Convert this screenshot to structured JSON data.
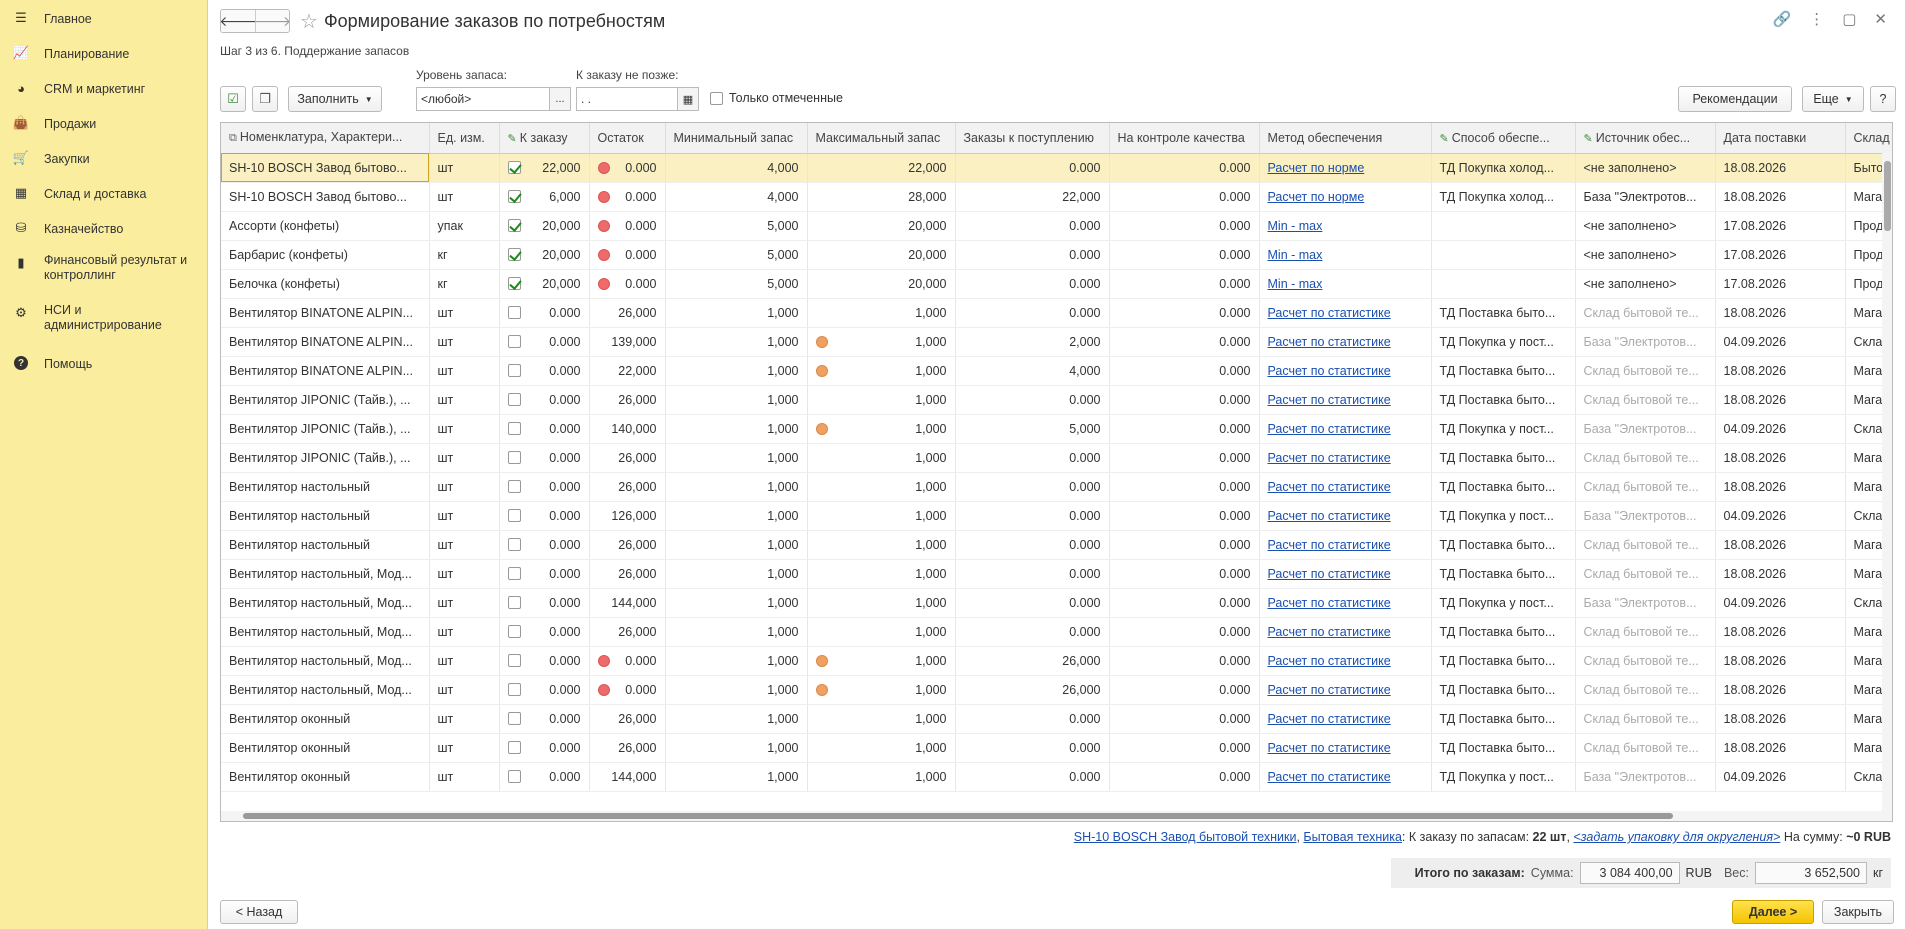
{
  "sidebar": {
    "items": [
      {
        "label": "Главное",
        "icon": "menu-icon"
      },
      {
        "label": "Планирование",
        "icon": "chart-icon"
      },
      {
        "label": "CRM и маркетинг",
        "icon": "pie-icon"
      },
      {
        "label": "Продажи",
        "icon": "bag-icon"
      },
      {
        "label": "Закупки",
        "icon": "cart-icon"
      },
      {
        "label": "Склад и доставка",
        "icon": "grid-icon"
      },
      {
        "label": "Казначейство",
        "icon": "coins-icon"
      },
      {
        "label": "Финансовый результат и контроллинг",
        "icon": "bar-chart-icon"
      },
      {
        "label": "НСИ и администрирование",
        "icon": "gear-icon"
      },
      {
        "label": "Помощь",
        "icon": "help-icon"
      }
    ]
  },
  "header": {
    "title": "Формирование заказов по потребностям",
    "step": "Шаг 3 из 6. Поддержание запасов"
  },
  "toolbar": {
    "fill_label": "Заполнить",
    "stock_level_label": "Уровень запаса:",
    "stock_level_value": "<любой>",
    "order_by_label": "К заказу не позже:",
    "order_by_value": ". .",
    "only_marked_label": "Только отмеченные",
    "recommendations_label": "Рекомендации",
    "more_label": "Еще",
    "help_label": "?"
  },
  "table": {
    "headers": [
      "Номенклатура, Характери...",
      "Ед. изм.",
      "К заказу",
      "Остаток",
      "Минимальный запас",
      "Максимальный запас",
      "Заказы к поступлению",
      "На контроле качества",
      "Метод обеспечения",
      "Способ обеспе...",
      "Источник обес...",
      "Дата поставки",
      "Склад"
    ],
    "rows": [
      {
        "name": "SH-10 BOSCH Завод бытово...",
        "unit": "шт",
        "checked": true,
        "order": "22,000",
        "rest_dot": "red",
        "rest": "0.000",
        "min": "4,000",
        "max": "22,000",
        "in_dot": "",
        "incoming": "0.000",
        "qc": "0.000",
        "method": "Расчет по норме",
        "way": "ТД Покупка холод...",
        "source": "<не заполнено>",
        "source_grey": false,
        "date": "18.08.2026",
        "wh": "Бытова"
      },
      {
        "name": "SH-10 BOSCH Завод бытово...",
        "unit": "шт",
        "checked": true,
        "order": "6,000",
        "rest_dot": "red",
        "rest": "0.000",
        "min": "4,000",
        "max": "28,000",
        "in_dot": "",
        "incoming": "22,000",
        "qc": "0.000",
        "method": "Расчет по норме",
        "way": "ТД Покупка холод...",
        "source": "База \"Электротов...",
        "source_grey": false,
        "date": "18.08.2026",
        "wh": "Магази"
      },
      {
        "name": "Ассорти (конфеты)",
        "unit": "упак",
        "checked": true,
        "order": "20,000",
        "rest_dot": "red",
        "rest": "0.000",
        "min": "5,000",
        "max": "20,000",
        "in_dot": "",
        "incoming": "0.000",
        "qc": "0.000",
        "method": "Min - max",
        "way": "",
        "source": "<не заполнено>",
        "source_grey": false,
        "date": "17.08.2026",
        "wh": "Продук"
      },
      {
        "name": "Барбарис (конфеты)",
        "unit": "кг",
        "checked": true,
        "order": "20,000",
        "rest_dot": "red",
        "rest": "0.000",
        "min": "5,000",
        "max": "20,000",
        "in_dot": "",
        "incoming": "0.000",
        "qc": "0.000",
        "method": "Min - max",
        "way": "",
        "source": "<не заполнено>",
        "source_grey": false,
        "date": "17.08.2026",
        "wh": "Продук"
      },
      {
        "name": "Белочка (конфеты)",
        "unit": "кг",
        "checked": true,
        "order": "20,000",
        "rest_dot": "red",
        "rest": "0.000",
        "min": "5,000",
        "max": "20,000",
        "in_dot": "",
        "incoming": "0.000",
        "qc": "0.000",
        "method": "Min - max",
        "way": "",
        "source": "<не заполнено>",
        "source_grey": false,
        "date": "17.08.2026",
        "wh": "Продук"
      },
      {
        "name": "Вентилятор BINATONE ALPIN...",
        "unit": "шт",
        "checked": false,
        "order": "0.000",
        "rest_dot": "",
        "rest": "26,000",
        "min": "1,000",
        "max": "1,000",
        "in_dot": "",
        "incoming": "0.000",
        "qc": "0.000",
        "method": "Расчет по статистике",
        "way": "ТД Поставка быто...",
        "source": "Склад бытовой те...",
        "source_grey": true,
        "date": "18.08.2026",
        "wh": "Магази"
      },
      {
        "name": "Вентилятор BINATONE ALPIN...",
        "unit": "шт",
        "checked": false,
        "order": "0.000",
        "rest_dot": "",
        "rest": "139,000",
        "min": "1,000",
        "max": "1,000",
        "in_dot": "or",
        "incoming": "2,000",
        "qc": "0.000",
        "method": "Расчет по статистике",
        "way": "ТД Покупка у пост...",
        "source": "База \"Электротов...",
        "source_grey": true,
        "date": "04.09.2026",
        "wh": "Склад"
      },
      {
        "name": "Вентилятор BINATONE ALPIN...",
        "unit": "шт",
        "checked": false,
        "order": "0.000",
        "rest_dot": "",
        "rest": "22,000",
        "min": "1,000",
        "max": "1,000",
        "in_dot": "or",
        "incoming": "4,000",
        "qc": "0.000",
        "method": "Расчет по статистике",
        "way": "ТД Поставка быто...",
        "source": "Склад бытовой те...",
        "source_grey": true,
        "date": "18.08.2026",
        "wh": "Магази"
      },
      {
        "name": "Вентилятор JIPONIC (Тайв.), ...",
        "unit": "шт",
        "checked": false,
        "order": "0.000",
        "rest_dot": "",
        "rest": "26,000",
        "min": "1,000",
        "max": "1,000",
        "in_dot": "",
        "incoming": "0.000",
        "qc": "0.000",
        "method": "Расчет по статистике",
        "way": "ТД Поставка быто...",
        "source": "Склад бытовой те...",
        "source_grey": true,
        "date": "18.08.2026",
        "wh": "Магази"
      },
      {
        "name": "Вентилятор JIPONIC (Тайв.), ...",
        "unit": "шт",
        "checked": false,
        "order": "0.000",
        "rest_dot": "",
        "rest": "140,000",
        "min": "1,000",
        "max": "1,000",
        "in_dot": "or",
        "incoming": "5,000",
        "qc": "0.000",
        "method": "Расчет по статистике",
        "way": "ТД Покупка у пост...",
        "source": "База \"Электротов...",
        "source_grey": true,
        "date": "04.09.2026",
        "wh": "Склад"
      },
      {
        "name": "Вентилятор JIPONIC (Тайв.), ...",
        "unit": "шт",
        "checked": false,
        "order": "0.000",
        "rest_dot": "",
        "rest": "26,000",
        "min": "1,000",
        "max": "1,000",
        "in_dot": "",
        "incoming": "0.000",
        "qc": "0.000",
        "method": "Расчет по статистике",
        "way": "ТД Поставка быто...",
        "source": "Склад бытовой те...",
        "source_grey": true,
        "date": "18.08.2026",
        "wh": "Магази"
      },
      {
        "name": "Вентилятор настольный",
        "unit": "шт",
        "checked": false,
        "order": "0.000",
        "rest_dot": "",
        "rest": "26,000",
        "min": "1,000",
        "max": "1,000",
        "in_dot": "",
        "incoming": "0.000",
        "qc": "0.000",
        "method": "Расчет по статистике",
        "way": "ТД Поставка быто...",
        "source": "Склад бытовой те...",
        "source_grey": true,
        "date": "18.08.2026",
        "wh": "Магази"
      },
      {
        "name": "Вентилятор настольный",
        "unit": "шт",
        "checked": false,
        "order": "0.000",
        "rest_dot": "",
        "rest": "126,000",
        "min": "1,000",
        "max": "1,000",
        "in_dot": "",
        "incoming": "0.000",
        "qc": "0.000",
        "method": "Расчет по статистике",
        "way": "ТД Покупка у пост...",
        "source": "База \"Электротов...",
        "source_grey": true,
        "date": "04.09.2026",
        "wh": "Склад"
      },
      {
        "name": "Вентилятор настольный",
        "unit": "шт",
        "checked": false,
        "order": "0.000",
        "rest_dot": "",
        "rest": "26,000",
        "min": "1,000",
        "max": "1,000",
        "in_dot": "",
        "incoming": "0.000",
        "qc": "0.000",
        "method": "Расчет по статистике",
        "way": "ТД Поставка быто...",
        "source": "Склад бытовой те...",
        "source_grey": true,
        "date": "18.08.2026",
        "wh": "Магази"
      },
      {
        "name": "Вентилятор настольный, Мод...",
        "unit": "шт",
        "checked": false,
        "order": "0.000",
        "rest_dot": "",
        "rest": "26,000",
        "min": "1,000",
        "max": "1,000",
        "in_dot": "",
        "incoming": "0.000",
        "qc": "0.000",
        "method": "Расчет по статистике",
        "way": "ТД Поставка быто...",
        "source": "Склад бытовой те...",
        "source_grey": true,
        "date": "18.08.2026",
        "wh": "Магази"
      },
      {
        "name": "Вентилятор настольный, Мод...",
        "unit": "шт",
        "checked": false,
        "order": "0.000",
        "rest_dot": "",
        "rest": "144,000",
        "min": "1,000",
        "max": "1,000",
        "in_dot": "",
        "incoming": "0.000",
        "qc": "0.000",
        "method": "Расчет по статистике",
        "way": "ТД Покупка у пост...",
        "source": "База \"Электротов...",
        "source_grey": true,
        "date": "04.09.2026",
        "wh": "Склад"
      },
      {
        "name": "Вентилятор настольный, Мод...",
        "unit": "шт",
        "checked": false,
        "order": "0.000",
        "rest_dot": "",
        "rest": "26,000",
        "min": "1,000",
        "max": "1,000",
        "in_dot": "",
        "incoming": "0.000",
        "qc": "0.000",
        "method": "Расчет по статистике",
        "way": "ТД Поставка быто...",
        "source": "Склад бытовой те...",
        "source_grey": true,
        "date": "18.08.2026",
        "wh": "Магази"
      },
      {
        "name": "Вентилятор настольный, Мод...",
        "unit": "шт",
        "checked": false,
        "order": "0.000",
        "rest_dot": "red",
        "rest": "0.000",
        "min": "1,000",
        "max": "1,000",
        "in_dot": "or",
        "incoming": "26,000",
        "qc": "0.000",
        "method": "Расчет по статистике",
        "way": "ТД Поставка быто...",
        "source": "Склад бытовой те...",
        "source_grey": true,
        "date": "18.08.2026",
        "wh": "Магази"
      },
      {
        "name": "Вентилятор настольный, Мод...",
        "unit": "шт",
        "checked": false,
        "order": "0.000",
        "rest_dot": "red",
        "rest": "0.000",
        "min": "1,000",
        "max": "1,000",
        "in_dot": "or",
        "incoming": "26,000",
        "qc": "0.000",
        "method": "Расчет по статистике",
        "way": "ТД Поставка быто...",
        "source": "Склад бытовой те...",
        "source_grey": true,
        "date": "18.08.2026",
        "wh": "Магази"
      },
      {
        "name": "Вентилятор оконный",
        "unit": "шт",
        "checked": false,
        "order": "0.000",
        "rest_dot": "",
        "rest": "26,000",
        "min": "1,000",
        "max": "1,000",
        "in_dot": "",
        "incoming": "0.000",
        "qc": "0.000",
        "method": "Расчет по статистике",
        "way": "ТД Поставка быто...",
        "source": "Склад бытовой те...",
        "source_grey": true,
        "date": "18.08.2026",
        "wh": "Магази"
      },
      {
        "name": "Вентилятор оконный",
        "unit": "шт",
        "checked": false,
        "order": "0.000",
        "rest_dot": "",
        "rest": "26,000",
        "min": "1,000",
        "max": "1,000",
        "in_dot": "",
        "incoming": "0.000",
        "qc": "0.000",
        "method": "Расчет по статистике",
        "way": "ТД Поставка быто...",
        "source": "Склад бытовой те...",
        "source_grey": true,
        "date": "18.08.2026",
        "wh": "Магази"
      },
      {
        "name": "Вентилятор оконный",
        "unit": "шт",
        "checked": false,
        "order": "0.000",
        "rest_dot": "",
        "rest": "144,000",
        "min": "1,000",
        "max": "1,000",
        "in_dot": "",
        "incoming": "0.000",
        "qc": "0.000",
        "method": "Расчет по статистике",
        "way": "ТД Покупка у пост...",
        "source": "База \"Электротов...",
        "source_grey": true,
        "date": "04.09.2026",
        "wh": "Склад"
      }
    ]
  },
  "footer": {
    "item_link": "SH-10 BOSCH Завод бытовой техники",
    "warehouse_link": "Бытовая техника",
    "order_text": "К заказу по запасам:",
    "order_value": "22 шт",
    "pack_link": "<задать упаковку для округления>",
    "sum_text": "На сумму:",
    "sum_value": "~0 RUB",
    "totals_label": "Итого по заказам:",
    "sum_label": "Сумма:",
    "sum_amount": "3 084 400,00",
    "currency": "RUB",
    "weight_label": "Вес:",
    "weight_amount": "3 652,500",
    "weight_unit": "кг"
  },
  "buttons": {
    "back": "< Назад",
    "next": "Далее >",
    "close": "Закрыть"
  }
}
